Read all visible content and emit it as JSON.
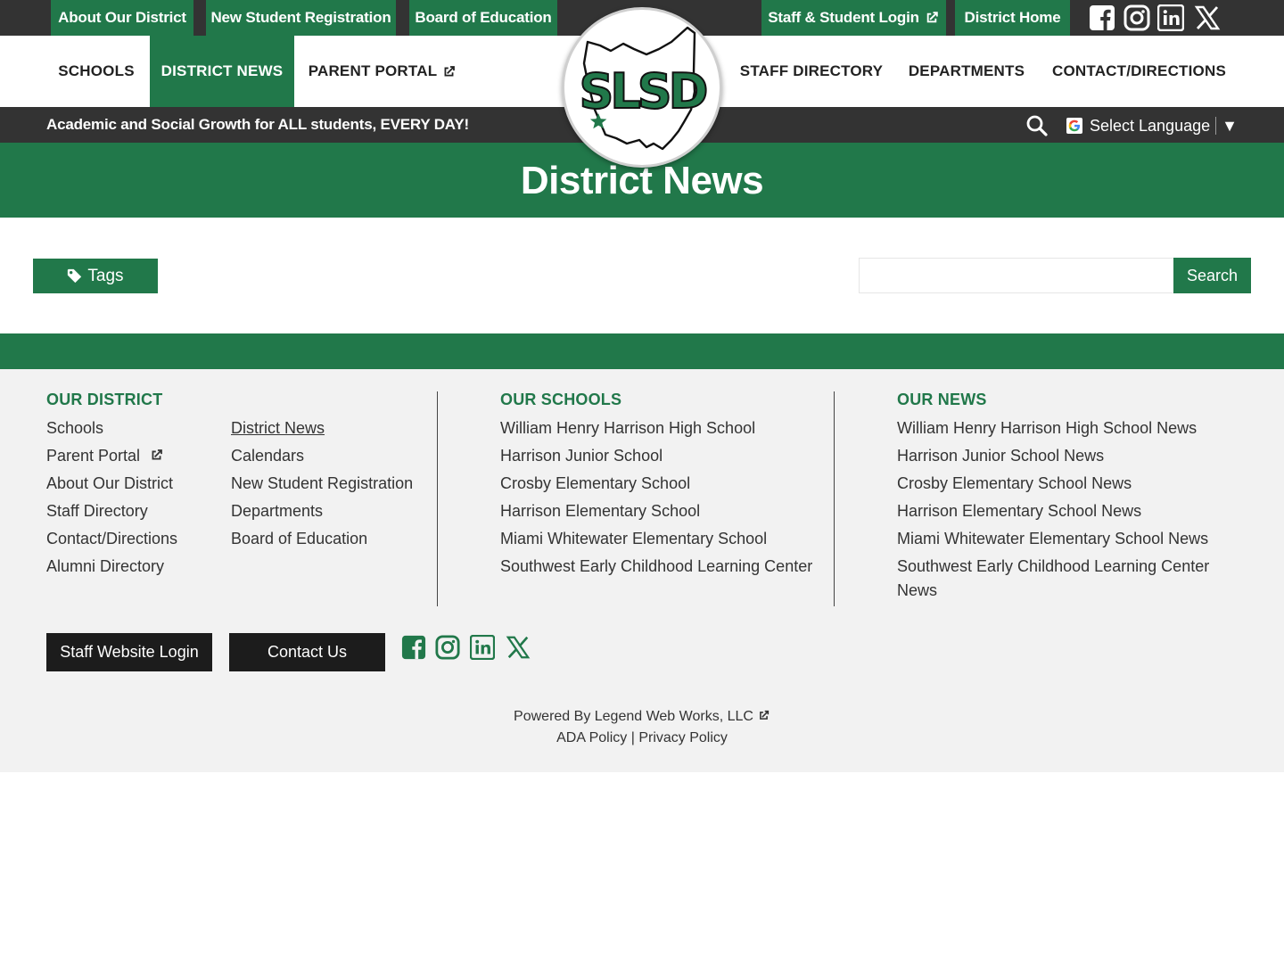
{
  "utility_nav": {
    "about": "About Our District",
    "new_student": "New Student Registration",
    "board": "Board of Education",
    "staff_login": "Staff & Student Login",
    "district_home": "District Home"
  },
  "main_nav": {
    "schools": "SCHOOLS",
    "district_news": "DISTRICT NEWS",
    "parent_portal": "PARENT PORTAL",
    "staff_directory": "STAFF DIRECTORY",
    "departments": "DEPARTMENTS",
    "contact": "CONTACT/DIRECTIONS"
  },
  "logo": {
    "text": "SLSD"
  },
  "tagline": "Academic and Social Growth for ALL students, EVERY DAY!",
  "language": {
    "label": "Select Language",
    "arrow": "▼"
  },
  "page": {
    "title": "District News"
  },
  "toolbar": {
    "tags_label": "Tags",
    "search_placeholder": "",
    "search_label": "Search"
  },
  "footer": {
    "district_heading": "OUR DISTRICT",
    "schools_heading": "OUR SCHOOLS",
    "news_heading": "OUR NEWS",
    "district_links_a": [
      "Schools",
      "Parent Portal",
      "About Our District",
      "Staff Directory",
      "Contact/Directions",
      "Alumni Directory"
    ],
    "district_links_b": [
      "District News",
      "Calendars",
      "New Student Registration",
      "Departments",
      "Board of Education"
    ],
    "school_links": [
      "William Henry Harrison High School",
      "Harrison Junior School",
      "Crosby Elementary School",
      "Harrison Elementary School",
      "Miami Whitewater Elementary School",
      "Southwest Early Childhood Learning Center"
    ],
    "news_links": [
      "William Henry Harrison High School News",
      "Harrison Junior School News",
      "Crosby Elementary School News",
      "Harrison Elementary School News",
      "Miami Whitewater Elementary School News",
      "Southwest Early Childhood Learning Center News"
    ],
    "staff_login": "Staff Website Login",
    "contact_us": "Contact Us",
    "powered_by": "Powered By Legend Web Works, LLC",
    "ada": "ADA Policy",
    "policy_sep": "|",
    "privacy": "Privacy Policy"
  },
  "colors": {
    "brand_green": "#21784a",
    "dark_bar": "#333333",
    "footer_bg": "#f2f2f2"
  },
  "icons": [
    "facebook-icon",
    "instagram-icon",
    "linkedin-icon",
    "x-icon",
    "external-link-icon",
    "search-icon",
    "tag-icon",
    "google-icon"
  ]
}
